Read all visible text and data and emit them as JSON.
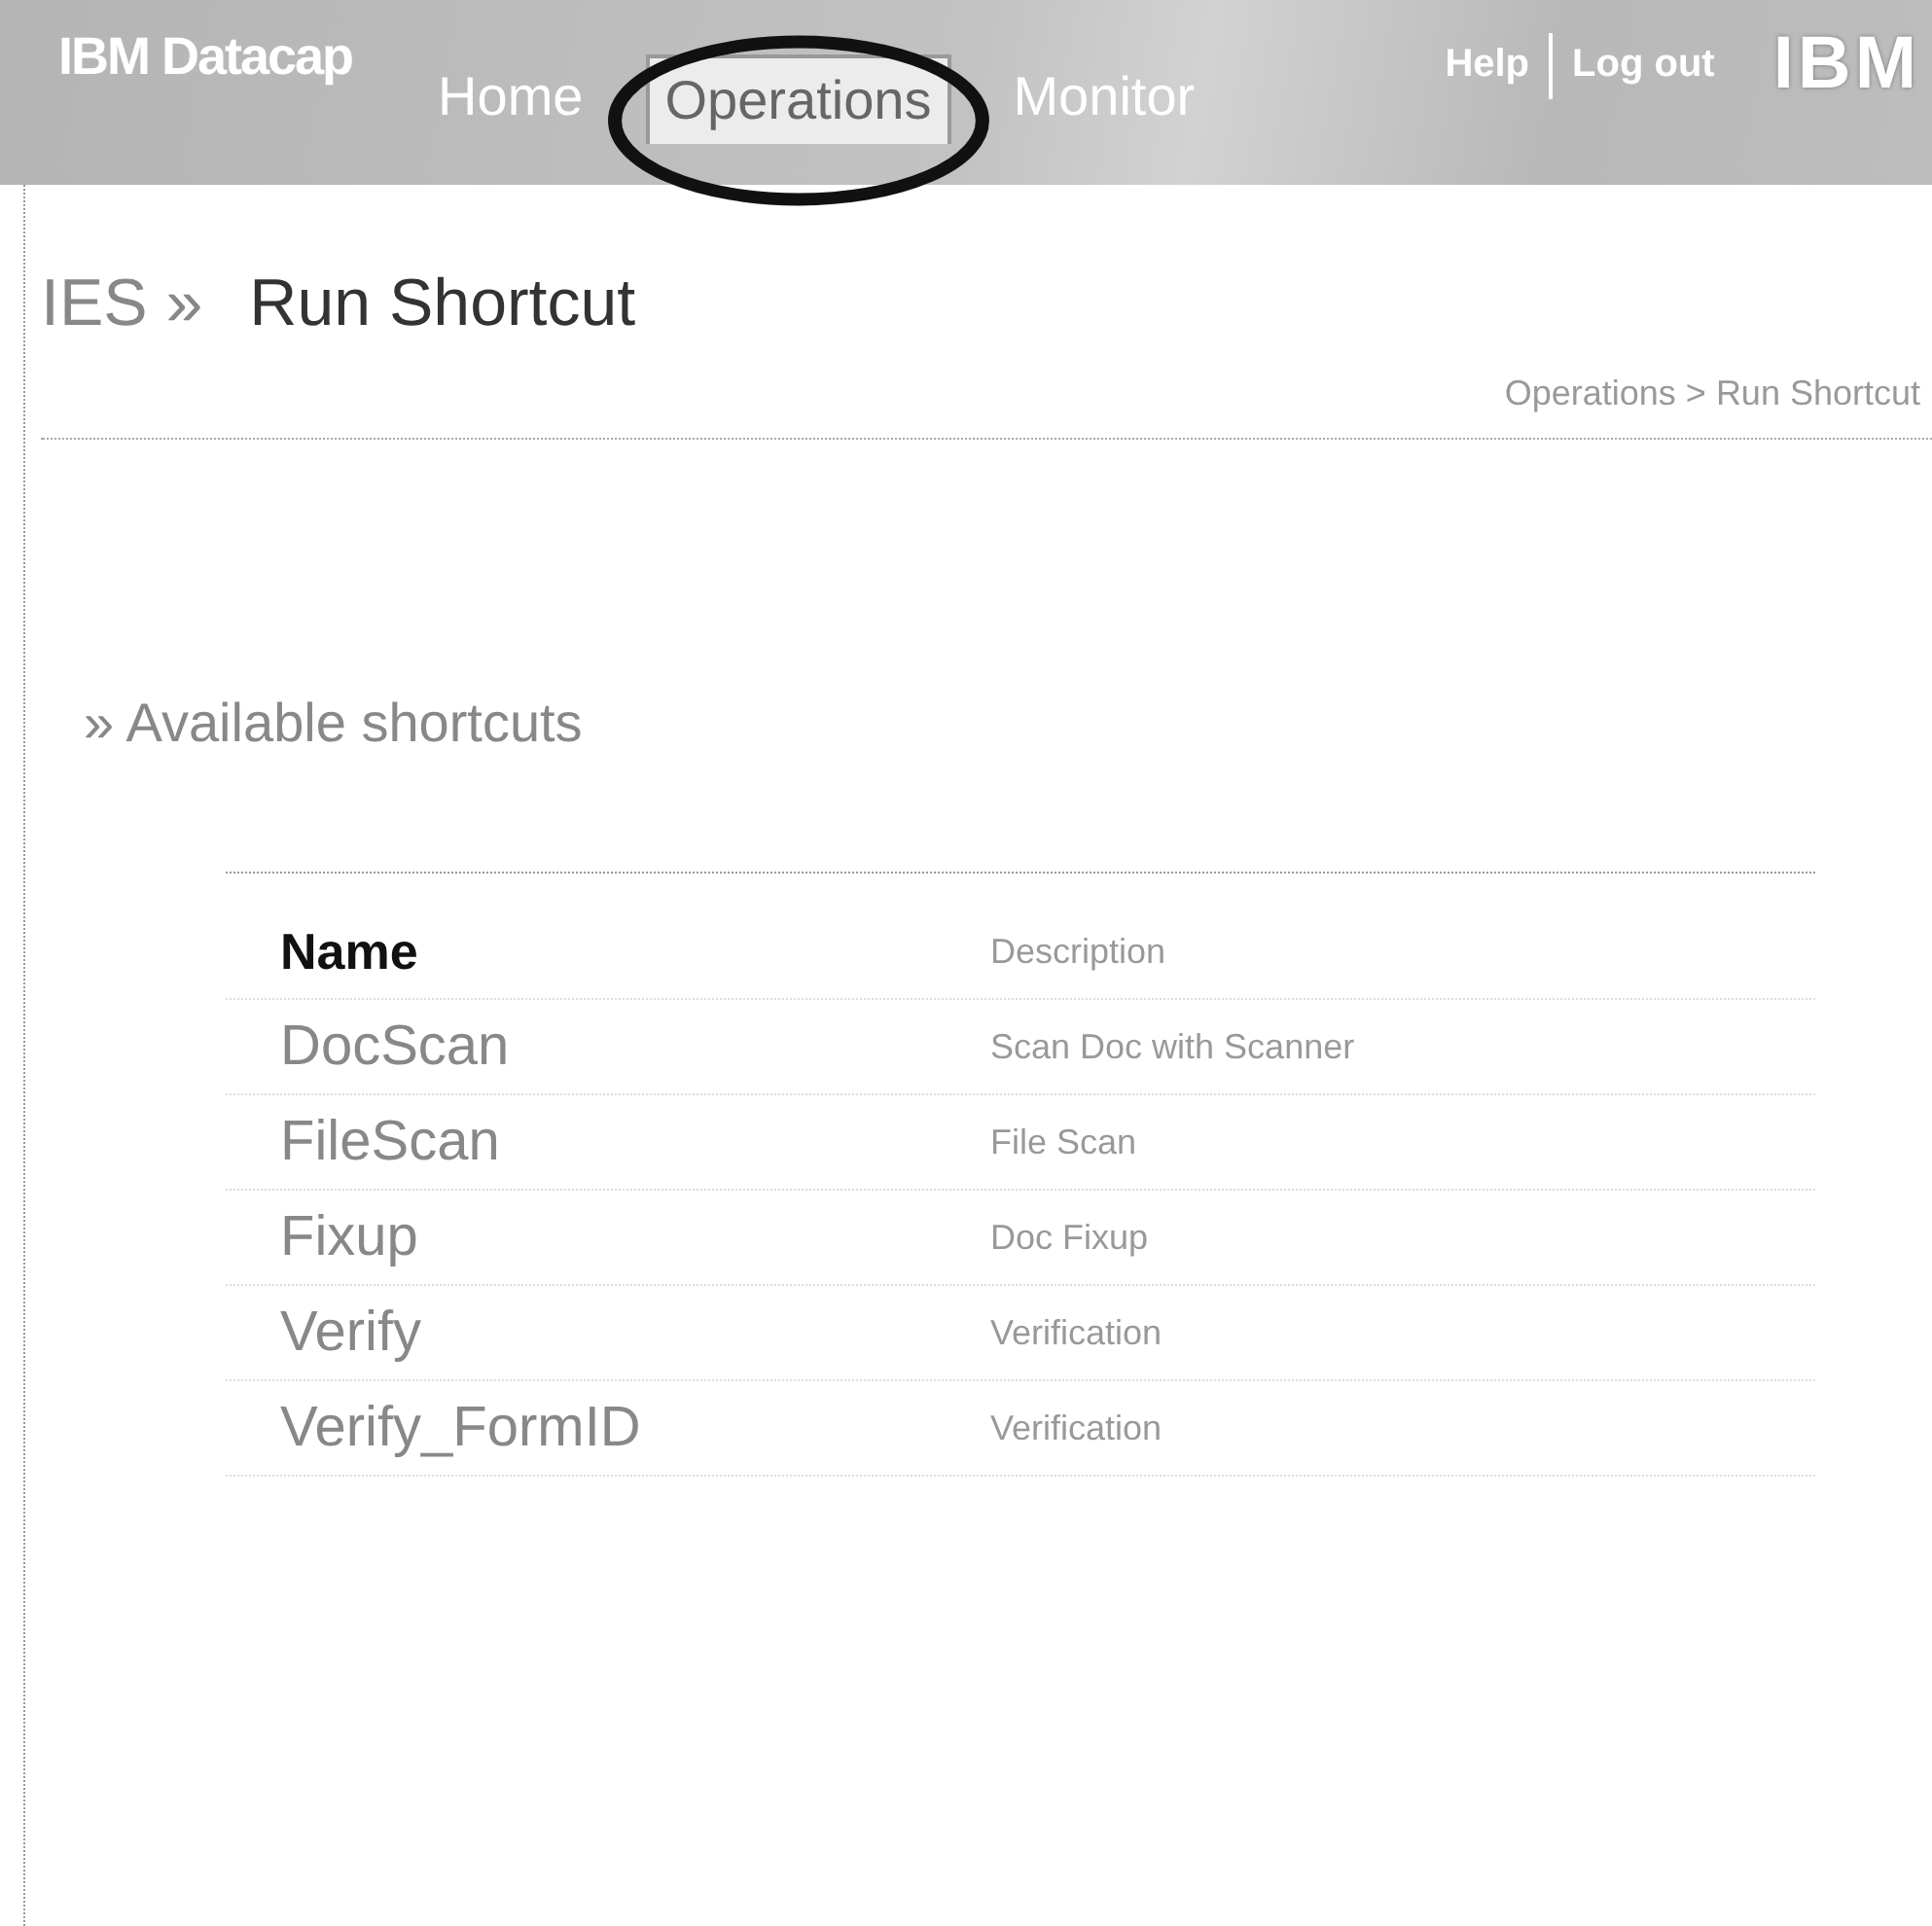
{
  "header": {
    "product": "IBM Datacap",
    "tabs": [
      {
        "label": "Home",
        "selected": false,
        "circled": false
      },
      {
        "label": "Operations",
        "selected": true,
        "circled": true
      },
      {
        "label": "Monitor",
        "selected": false,
        "circled": false
      }
    ],
    "links": [
      "Help",
      "Log out"
    ],
    "logo": "IBM"
  },
  "page_title": {
    "prefix": "IES »",
    "title": "Run Shortcut"
  },
  "breadcrumb": "Operations > Run Shortcut",
  "section_title": "» Available shortcuts",
  "table": {
    "columns": [
      "Name",
      "Description"
    ],
    "rows": [
      {
        "name": "DocScan",
        "description": "Scan Doc with Scanner"
      },
      {
        "name": "FileScan",
        "description": "File Scan"
      },
      {
        "name": "Fixup",
        "description": "Doc Fixup"
      },
      {
        "name": "Verify",
        "description": "Verification"
      },
      {
        "name": "Verify_FormID",
        "description": "Verification"
      }
    ]
  }
}
